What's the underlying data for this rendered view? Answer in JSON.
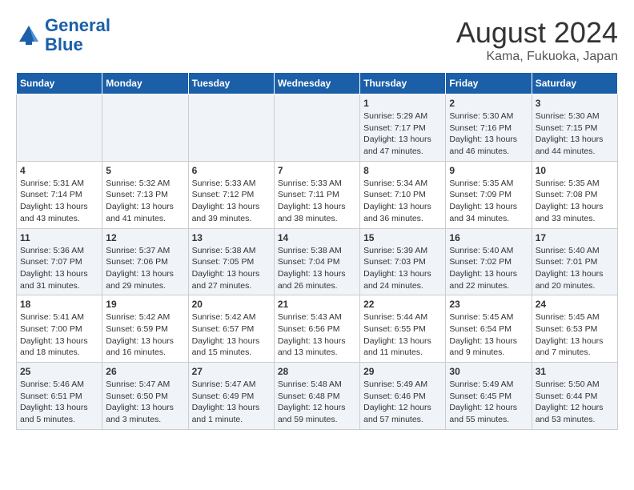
{
  "header": {
    "logo_line1": "General",
    "logo_line2": "Blue",
    "main_title": "August 2024",
    "subtitle": "Kama, Fukuoka, Japan"
  },
  "weekdays": [
    "Sunday",
    "Monday",
    "Tuesday",
    "Wednesday",
    "Thursday",
    "Friday",
    "Saturday"
  ],
  "weeks": [
    [
      {
        "day": "",
        "info": ""
      },
      {
        "day": "",
        "info": ""
      },
      {
        "day": "",
        "info": ""
      },
      {
        "day": "",
        "info": ""
      },
      {
        "day": "1",
        "info": "Sunrise: 5:29 AM\nSunset: 7:17 PM\nDaylight: 13 hours\nand 47 minutes."
      },
      {
        "day": "2",
        "info": "Sunrise: 5:30 AM\nSunset: 7:16 PM\nDaylight: 13 hours\nand 46 minutes."
      },
      {
        "day": "3",
        "info": "Sunrise: 5:30 AM\nSunset: 7:15 PM\nDaylight: 13 hours\nand 44 minutes."
      }
    ],
    [
      {
        "day": "4",
        "info": "Sunrise: 5:31 AM\nSunset: 7:14 PM\nDaylight: 13 hours\nand 43 minutes."
      },
      {
        "day": "5",
        "info": "Sunrise: 5:32 AM\nSunset: 7:13 PM\nDaylight: 13 hours\nand 41 minutes."
      },
      {
        "day": "6",
        "info": "Sunrise: 5:33 AM\nSunset: 7:12 PM\nDaylight: 13 hours\nand 39 minutes."
      },
      {
        "day": "7",
        "info": "Sunrise: 5:33 AM\nSunset: 7:11 PM\nDaylight: 13 hours\nand 38 minutes."
      },
      {
        "day": "8",
        "info": "Sunrise: 5:34 AM\nSunset: 7:10 PM\nDaylight: 13 hours\nand 36 minutes."
      },
      {
        "day": "9",
        "info": "Sunrise: 5:35 AM\nSunset: 7:09 PM\nDaylight: 13 hours\nand 34 minutes."
      },
      {
        "day": "10",
        "info": "Sunrise: 5:35 AM\nSunset: 7:08 PM\nDaylight: 13 hours\nand 33 minutes."
      }
    ],
    [
      {
        "day": "11",
        "info": "Sunrise: 5:36 AM\nSunset: 7:07 PM\nDaylight: 13 hours\nand 31 minutes."
      },
      {
        "day": "12",
        "info": "Sunrise: 5:37 AM\nSunset: 7:06 PM\nDaylight: 13 hours\nand 29 minutes."
      },
      {
        "day": "13",
        "info": "Sunrise: 5:38 AM\nSunset: 7:05 PM\nDaylight: 13 hours\nand 27 minutes."
      },
      {
        "day": "14",
        "info": "Sunrise: 5:38 AM\nSunset: 7:04 PM\nDaylight: 13 hours\nand 26 minutes."
      },
      {
        "day": "15",
        "info": "Sunrise: 5:39 AM\nSunset: 7:03 PM\nDaylight: 13 hours\nand 24 minutes."
      },
      {
        "day": "16",
        "info": "Sunrise: 5:40 AM\nSunset: 7:02 PM\nDaylight: 13 hours\nand 22 minutes."
      },
      {
        "day": "17",
        "info": "Sunrise: 5:40 AM\nSunset: 7:01 PM\nDaylight: 13 hours\nand 20 minutes."
      }
    ],
    [
      {
        "day": "18",
        "info": "Sunrise: 5:41 AM\nSunset: 7:00 PM\nDaylight: 13 hours\nand 18 minutes."
      },
      {
        "day": "19",
        "info": "Sunrise: 5:42 AM\nSunset: 6:59 PM\nDaylight: 13 hours\nand 16 minutes."
      },
      {
        "day": "20",
        "info": "Sunrise: 5:42 AM\nSunset: 6:57 PM\nDaylight: 13 hours\nand 15 minutes."
      },
      {
        "day": "21",
        "info": "Sunrise: 5:43 AM\nSunset: 6:56 PM\nDaylight: 13 hours\nand 13 minutes."
      },
      {
        "day": "22",
        "info": "Sunrise: 5:44 AM\nSunset: 6:55 PM\nDaylight: 13 hours\nand 11 minutes."
      },
      {
        "day": "23",
        "info": "Sunrise: 5:45 AM\nSunset: 6:54 PM\nDaylight: 13 hours\nand 9 minutes."
      },
      {
        "day": "24",
        "info": "Sunrise: 5:45 AM\nSunset: 6:53 PM\nDaylight: 13 hours\nand 7 minutes."
      }
    ],
    [
      {
        "day": "25",
        "info": "Sunrise: 5:46 AM\nSunset: 6:51 PM\nDaylight: 13 hours\nand 5 minutes."
      },
      {
        "day": "26",
        "info": "Sunrise: 5:47 AM\nSunset: 6:50 PM\nDaylight: 13 hours\nand 3 minutes."
      },
      {
        "day": "27",
        "info": "Sunrise: 5:47 AM\nSunset: 6:49 PM\nDaylight: 13 hours\nand 1 minute."
      },
      {
        "day": "28",
        "info": "Sunrise: 5:48 AM\nSunset: 6:48 PM\nDaylight: 12 hours\nand 59 minutes."
      },
      {
        "day": "29",
        "info": "Sunrise: 5:49 AM\nSunset: 6:46 PM\nDaylight: 12 hours\nand 57 minutes."
      },
      {
        "day": "30",
        "info": "Sunrise: 5:49 AM\nSunset: 6:45 PM\nDaylight: 12 hours\nand 55 minutes."
      },
      {
        "day": "31",
        "info": "Sunrise: 5:50 AM\nSunset: 6:44 PM\nDaylight: 12 hours\nand 53 minutes."
      }
    ]
  ]
}
